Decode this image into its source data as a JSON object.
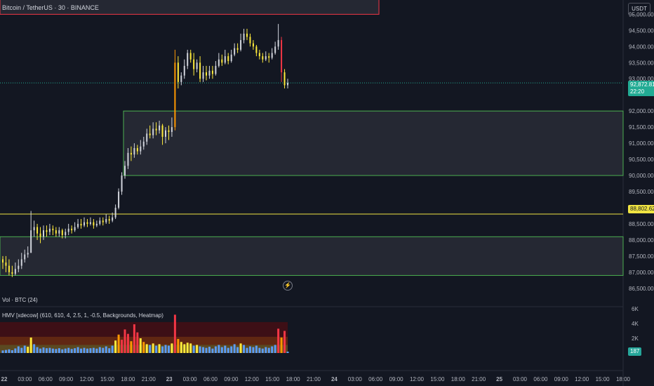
{
  "header": {
    "title": "Bitcoin / TetherUS · 30 · BINANCE",
    "currency": "USDT"
  },
  "price_axis": {
    "labels": [
      "95,000.00",
      "94,500.00",
      "94,000.00",
      "93,500.00",
      "93,000.00",
      "92,000.00",
      "91,500.00",
      "91,000.00",
      "90,500.00",
      "90,000.00",
      "89,500.00",
      "89,000.00",
      "88,500.00",
      "88,000.00",
      "87,500.00",
      "87,000.00",
      "86,500.00"
    ],
    "current_price": "92,872.81",
    "countdown": "22:20",
    "level_price": "88,802.62"
  },
  "time_axis": {
    "labels": [
      "22",
      "03:00",
      "06:00",
      "09:00",
      "12:00",
      "15:00",
      "18:00",
      "21:00",
      "23",
      "03:00",
      "06:00",
      "09:00",
      "12:00",
      "15:00",
      "18:00",
      "21:00",
      "24",
      "03:00",
      "06:00",
      "09:00",
      "12:00",
      "15:00",
      "18:00",
      "21:00",
      "25",
      "03:00",
      "06:00",
      "09:00",
      "12:00",
      "15:00",
      "18:00"
    ]
  },
  "volume_pane": {
    "title": "Vol · BTC (24)"
  },
  "hmv_pane": {
    "title": "HMV [xdecow] (610, 610, 4, 2.5, 1, -0.5, Backgrounds, Heatmap)",
    "axis_labels": [
      "6K",
      "4K",
      "2K"
    ],
    "last_value": "187"
  },
  "colors": {
    "background": "#131722",
    "up_candle": "#b2b5be",
    "zone_border": "#4caf50",
    "level_line": "#f0e442",
    "resistance_border": "#f23645",
    "price_tag": "#22ab94"
  },
  "chart_data": {
    "type": "candlestick",
    "symbol": "Bitcoin / TetherUS",
    "interval": "30",
    "exchange": "BINANCE",
    "y_range": [
      86300,
      95400
    ],
    "zones": [
      {
        "from": 95000,
        "to": 95500,
        "border": "#f23645"
      },
      {
        "from": 90000,
        "to": 92000,
        "border": "#4caf50"
      },
      {
        "from": 86900,
        "to": 88100,
        "border": "#4caf50"
      }
    ],
    "horizontal_levels": [
      88802.62
    ],
    "candles": [
      [
        87400,
        87300,
        87500,
        87100
      ],
      [
        87300,
        87200,
        87500,
        87000
      ],
      [
        87200,
        87000,
        87400,
        86900
      ],
      [
        87000,
        86950,
        87200,
        86850
      ],
      [
        86950,
        87100,
        87300,
        86900
      ],
      [
        87100,
        87200,
        87400,
        87000
      ],
      [
        87200,
        87400,
        87600,
        87100
      ],
      [
        87400,
        87550,
        87700,
        87300
      ],
      [
        87550,
        87600,
        87800,
        87450
      ],
      [
        87600,
        88300,
        88900,
        87600
      ],
      [
        88300,
        88400,
        88600,
        88100
      ],
      [
        88400,
        88200,
        88500,
        88000
      ],
      [
        88200,
        88100,
        88400,
        87900
      ],
      [
        88100,
        88300,
        88450,
        88000
      ],
      [
        88300,
        88250,
        88450,
        88100
      ],
      [
        88250,
        88350,
        88500,
        88150
      ],
      [
        88350,
        88300,
        88450,
        88150
      ],
      [
        88300,
        88200,
        88400,
        88100
      ],
      [
        88200,
        88300,
        88400,
        88100
      ],
      [
        88300,
        88150,
        88350,
        88050
      ],
      [
        88150,
        88250,
        88350,
        88050
      ],
      [
        88250,
        88350,
        88500,
        88150
      ],
      [
        88350,
        88300,
        88450,
        88200
      ],
      [
        88300,
        88400,
        88550,
        88250
      ],
      [
        88400,
        88500,
        88650,
        88350
      ],
      [
        88500,
        88450,
        88650,
        88350
      ],
      [
        88450,
        88550,
        88700,
        88400
      ],
      [
        88550,
        88500,
        88650,
        88400
      ],
      [
        88500,
        88550,
        88700,
        88450
      ],
      [
        88550,
        88450,
        88650,
        88350
      ],
      [
        88450,
        88500,
        88600,
        88400
      ],
      [
        88500,
        88600,
        88700,
        88450
      ],
      [
        88600,
        88550,
        88700,
        88450
      ],
      [
        88550,
        88650,
        88800,
        88500
      ],
      [
        88650,
        88600,
        88750,
        88500
      ],
      [
        88600,
        88700,
        88850,
        88550
      ],
      [
        88700,
        89000,
        89100,
        88650
      ],
      [
        89000,
        89500,
        89600,
        88950
      ],
      [
        89500,
        90000,
        90100,
        89400
      ],
      [
        90000,
        90300,
        90450,
        89900
      ],
      [
        90300,
        90700,
        90850,
        90200
      ],
      [
        90700,
        90650,
        90900,
        90450
      ],
      [
        90650,
        90850,
        91000,
        90550
      ],
      [
        90850,
        90750,
        90950,
        90650
      ],
      [
        90750,
        90900,
        91100,
        90650
      ],
      [
        90900,
        91050,
        91200,
        90800
      ],
      [
        91050,
        91300,
        91450,
        90950
      ],
      [
        91300,
        91250,
        91550,
        91150
      ],
      [
        91250,
        91450,
        91650,
        91150
      ],
      [
        91450,
        91400,
        91650,
        91250
      ],
      [
        91400,
        91550,
        91700,
        91300
      ],
      [
        91550,
        91200,
        91600,
        90950
      ],
      [
        91200,
        91400,
        91500,
        91000
      ],
      [
        91400,
        91350,
        91550,
        91100
      ],
      [
        91350,
        91500,
        91800,
        91200
      ],
      [
        91500,
        93500,
        93900,
        91400
      ],
      [
        93500,
        92900,
        93700,
        92700
      ],
      [
        92900,
        93100,
        93200,
        92800
      ],
      [
        93100,
        93400,
        93600,
        93000
      ],
      [
        93400,
        93800,
        93900,
        93300
      ],
      [
        93800,
        93600,
        93900,
        93500
      ],
      [
        93600,
        93300,
        93800,
        93100
      ],
      [
        93300,
        93500,
        93600,
        93200
      ],
      [
        93500,
        93000,
        93700,
        92900
      ],
      [
        93000,
        93200,
        93400,
        92900
      ],
      [
        93200,
        93100,
        93400,
        92950
      ],
      [
        93100,
        93250,
        93400,
        93000
      ],
      [
        93250,
        93150,
        93400,
        93000
      ],
      [
        93150,
        93400,
        93550,
        93100
      ],
      [
        93400,
        93600,
        93800,
        93350
      ],
      [
        93600,
        93500,
        93750,
        93400
      ],
      [
        93500,
        93700,
        93900,
        93450
      ],
      [
        93700,
        93550,
        93800,
        93450
      ],
      [
        93550,
        93750,
        93900,
        93500
      ],
      [
        93750,
        93950,
        94100,
        93700
      ],
      [
        93950,
        93900,
        94100,
        93800
      ],
      [
        93900,
        94200,
        94400,
        93850
      ],
      [
        94200,
        94400,
        94550,
        94100
      ],
      [
        94400,
        94300,
        94550,
        94200
      ],
      [
        94300,
        94100,
        94400,
        94000
      ],
      [
        94100,
        94000,
        94200,
        93900
      ],
      [
        94000,
        93800,
        94050,
        93700
      ],
      [
        93800,
        93700,
        93900,
        93600
      ],
      [
        93700,
        93600,
        93800,
        93500
      ],
      [
        93600,
        93700,
        93850,
        93550
      ],
      [
        93700,
        93650,
        93800,
        93500
      ],
      [
        93650,
        93800,
        93950,
        93600
      ],
      [
        93800,
        94000,
        94150,
        93750
      ],
      [
        94000,
        94200,
        94700,
        93900
      ],
      [
        94200,
        93200,
        94300,
        92900
      ],
      [
        93200,
        92800,
        93300,
        92700
      ],
      [
        92800,
        92873,
        93000,
        92700
      ]
    ],
    "volumes": [
      {
        "v": 350,
        "c": "#5b9cf6"
      },
      {
        "v": 420,
        "c": "#5b9cf6"
      },
      {
        "v": 500,
        "c": "#5b9cf6"
      },
      {
        "v": 380,
        "c": "#5b9cf6"
      },
      {
        "v": 620,
        "c": "#5b9cf6"
      },
      {
        "v": 900,
        "c": "#5b9cf6"
      },
      {
        "v": 700,
        "c": "#5b9cf6"
      },
      {
        "v": 1000,
        "c": "#5b9cf6"
      },
      {
        "v": 850,
        "c": "#ffeb3b"
      },
      {
        "v": 2100,
        "c": "#ffeb3b"
      },
      {
        "v": 1200,
        "c": "#5b9cf6"
      },
      {
        "v": 800,
        "c": "#5b9cf6"
      },
      {
        "v": 600,
        "c": "#5b9cf6"
      },
      {
        "v": 750,
        "c": "#5b9cf6"
      },
      {
        "v": 650,
        "c": "#5b9cf6"
      },
      {
        "v": 700,
        "c": "#5b9cf6"
      },
      {
        "v": 600,
        "c": "#5b9cf6"
      },
      {
        "v": 550,
        "c": "#5b9cf6"
      },
      {
        "v": 650,
        "c": "#5b9cf6"
      },
      {
        "v": 500,
        "c": "#5b9cf6"
      },
      {
        "v": 600,
        "c": "#5b9cf6"
      },
      {
        "v": 700,
        "c": "#5b9cf6"
      },
      {
        "v": 550,
        "c": "#5b9cf6"
      },
      {
        "v": 650,
        "c": "#5b9cf6"
      },
      {
        "v": 800,
        "c": "#5b9cf6"
      },
      {
        "v": 600,
        "c": "#5b9cf6"
      },
      {
        "v": 700,
        "c": "#5b9cf6"
      },
      {
        "v": 600,
        "c": "#5b9cf6"
      },
      {
        "v": 650,
        "c": "#5b9cf6"
      },
      {
        "v": 700,
        "c": "#5b9cf6"
      },
      {
        "v": 600,
        "c": "#5b9cf6"
      },
      {
        "v": 800,
        "c": "#5b9cf6"
      },
      {
        "v": 700,
        "c": "#5b9cf6"
      },
      {
        "v": 900,
        "c": "#5b9cf6"
      },
      {
        "v": 650,
        "c": "#5b9cf6"
      },
      {
        "v": 1000,
        "c": "#5b9cf6"
      },
      {
        "v": 1700,
        "c": "#ffeb3b"
      },
      {
        "v": 2500,
        "c": "#ff9800"
      },
      {
        "v": 1800,
        "c": "#f23645"
      },
      {
        "v": 3200,
        "c": "#f23645"
      },
      {
        "v": 2600,
        "c": "#f23645"
      },
      {
        "v": 1600,
        "c": "#ff9800"
      },
      {
        "v": 3900,
        "c": "#f23645"
      },
      {
        "v": 2800,
        "c": "#f23645"
      },
      {
        "v": 2000,
        "c": "#ffeb3b"
      },
      {
        "v": 1500,
        "c": "#ff9800"
      },
      {
        "v": 1200,
        "c": "#ffeb3b"
      },
      {
        "v": 1100,
        "c": "#5b9cf6"
      },
      {
        "v": 1300,
        "c": "#ffeb3b"
      },
      {
        "v": 1000,
        "c": "#5b9cf6"
      },
      {
        "v": 1200,
        "c": "#ffeb3b"
      },
      {
        "v": 900,
        "c": "#5b9cf6"
      },
      {
        "v": 1100,
        "c": "#5b9cf6"
      },
      {
        "v": 1000,
        "c": "#5b9cf6"
      },
      {
        "v": 1300,
        "c": "#ffeb3b"
      },
      {
        "v": 5200,
        "c": "#f23645"
      },
      {
        "v": 1900,
        "c": "#ff9800"
      },
      {
        "v": 1500,
        "c": "#ffeb3b"
      },
      {
        "v": 1200,
        "c": "#ffeb3b"
      },
      {
        "v": 1400,
        "c": "#ffeb3b"
      },
      {
        "v": 1300,
        "c": "#ffeb3b"
      },
      {
        "v": 1000,
        "c": "#5b9cf6"
      },
      {
        "v": 1100,
        "c": "#ffeb3b"
      },
      {
        "v": 900,
        "c": "#5b9cf6"
      },
      {
        "v": 800,
        "c": "#5b9cf6"
      },
      {
        "v": 700,
        "c": "#5b9cf6"
      },
      {
        "v": 850,
        "c": "#5b9cf6"
      },
      {
        "v": 600,
        "c": "#5b9cf6"
      },
      {
        "v": 900,
        "c": "#5b9cf6"
      },
      {
        "v": 1100,
        "c": "#5b9cf6"
      },
      {
        "v": 800,
        "c": "#5b9cf6"
      },
      {
        "v": 1000,
        "c": "#5b9cf6"
      },
      {
        "v": 700,
        "c": "#5b9cf6"
      },
      {
        "v": 900,
        "c": "#5b9cf6"
      },
      {
        "v": 1200,
        "c": "#5b9cf6"
      },
      {
        "v": 800,
        "c": "#5b9cf6"
      },
      {
        "v": 1300,
        "c": "#ffeb3b"
      },
      {
        "v": 1100,
        "c": "#5b9cf6"
      },
      {
        "v": 700,
        "c": "#5b9cf6"
      },
      {
        "v": 900,
        "c": "#5b9cf6"
      },
      {
        "v": 800,
        "c": "#5b9cf6"
      },
      {
        "v": 1000,
        "c": "#5b9cf6"
      },
      {
        "v": 700,
        "c": "#5b9cf6"
      },
      {
        "v": 600,
        "c": "#5b9cf6"
      },
      {
        "v": 800,
        "c": "#5b9cf6"
      },
      {
        "v": 700,
        "c": "#5b9cf6"
      },
      {
        "v": 900,
        "c": "#5b9cf6"
      },
      {
        "v": 1100,
        "c": "#5b9cf6"
      },
      {
        "v": 3300,
        "c": "#f23645"
      },
      {
        "v": 2100,
        "c": "#ff9800"
      },
      {
        "v": 3000,
        "c": "#f23645"
      },
      {
        "v": 187,
        "c": "#5b9cf6"
      }
    ]
  }
}
